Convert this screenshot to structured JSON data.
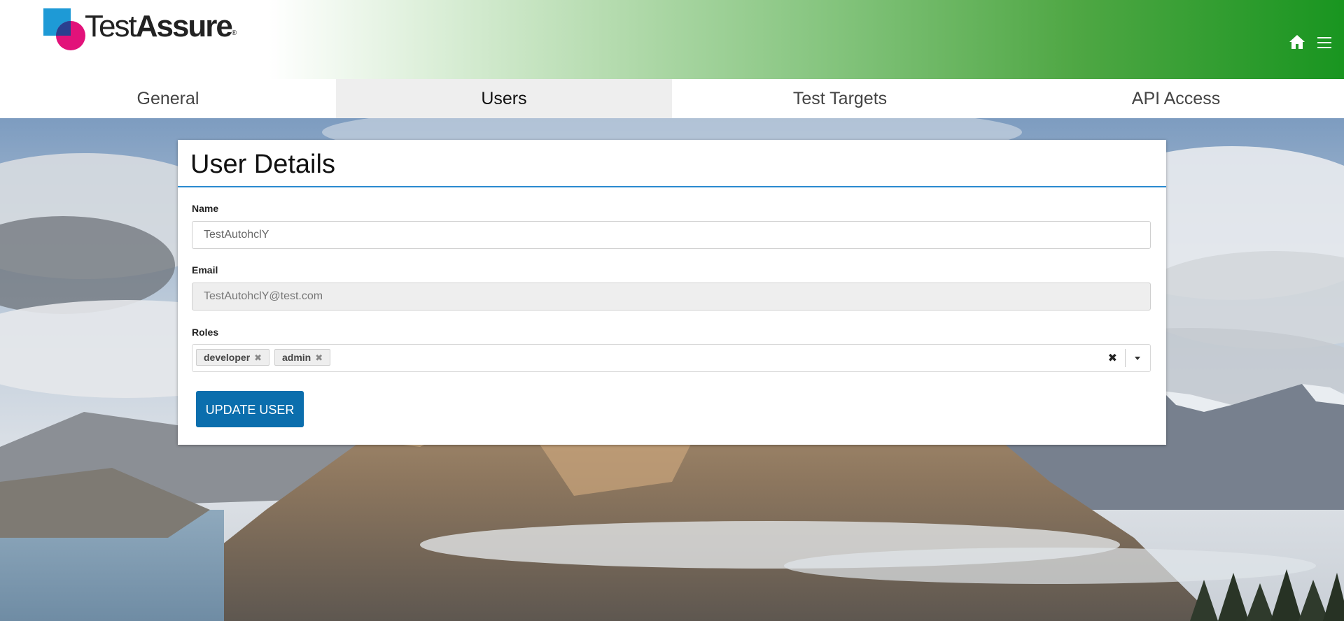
{
  "app": {
    "logo_light": "Test",
    "logo_bold": "Assure",
    "logo_reg": "®"
  },
  "header": {
    "icons": [
      "home-icon",
      "menu-icon"
    ]
  },
  "tabs": [
    {
      "label": "General",
      "active": false
    },
    {
      "label": "Users",
      "active": true
    },
    {
      "label": "Test Targets",
      "active": false
    },
    {
      "label": "API Access",
      "active": false
    }
  ],
  "card": {
    "title": "User Details",
    "name": {
      "label": "Name",
      "value": "TestAutohclY"
    },
    "email": {
      "label": "Email",
      "value": "TestAutohclY@test.com"
    },
    "roles": {
      "label": "Roles",
      "selected": [
        "developer",
        "admin"
      ],
      "remove_glyph": "✖",
      "clear_glyph": "✖"
    },
    "submit_label": "UPDATE USER"
  },
  "colors": {
    "header_gradient_end": "#199520",
    "button": "#0b6ead",
    "title_underline": "#2a8ad0",
    "logo_blue": "#1e9ad6",
    "logo_magenta": "#e2127a"
  }
}
